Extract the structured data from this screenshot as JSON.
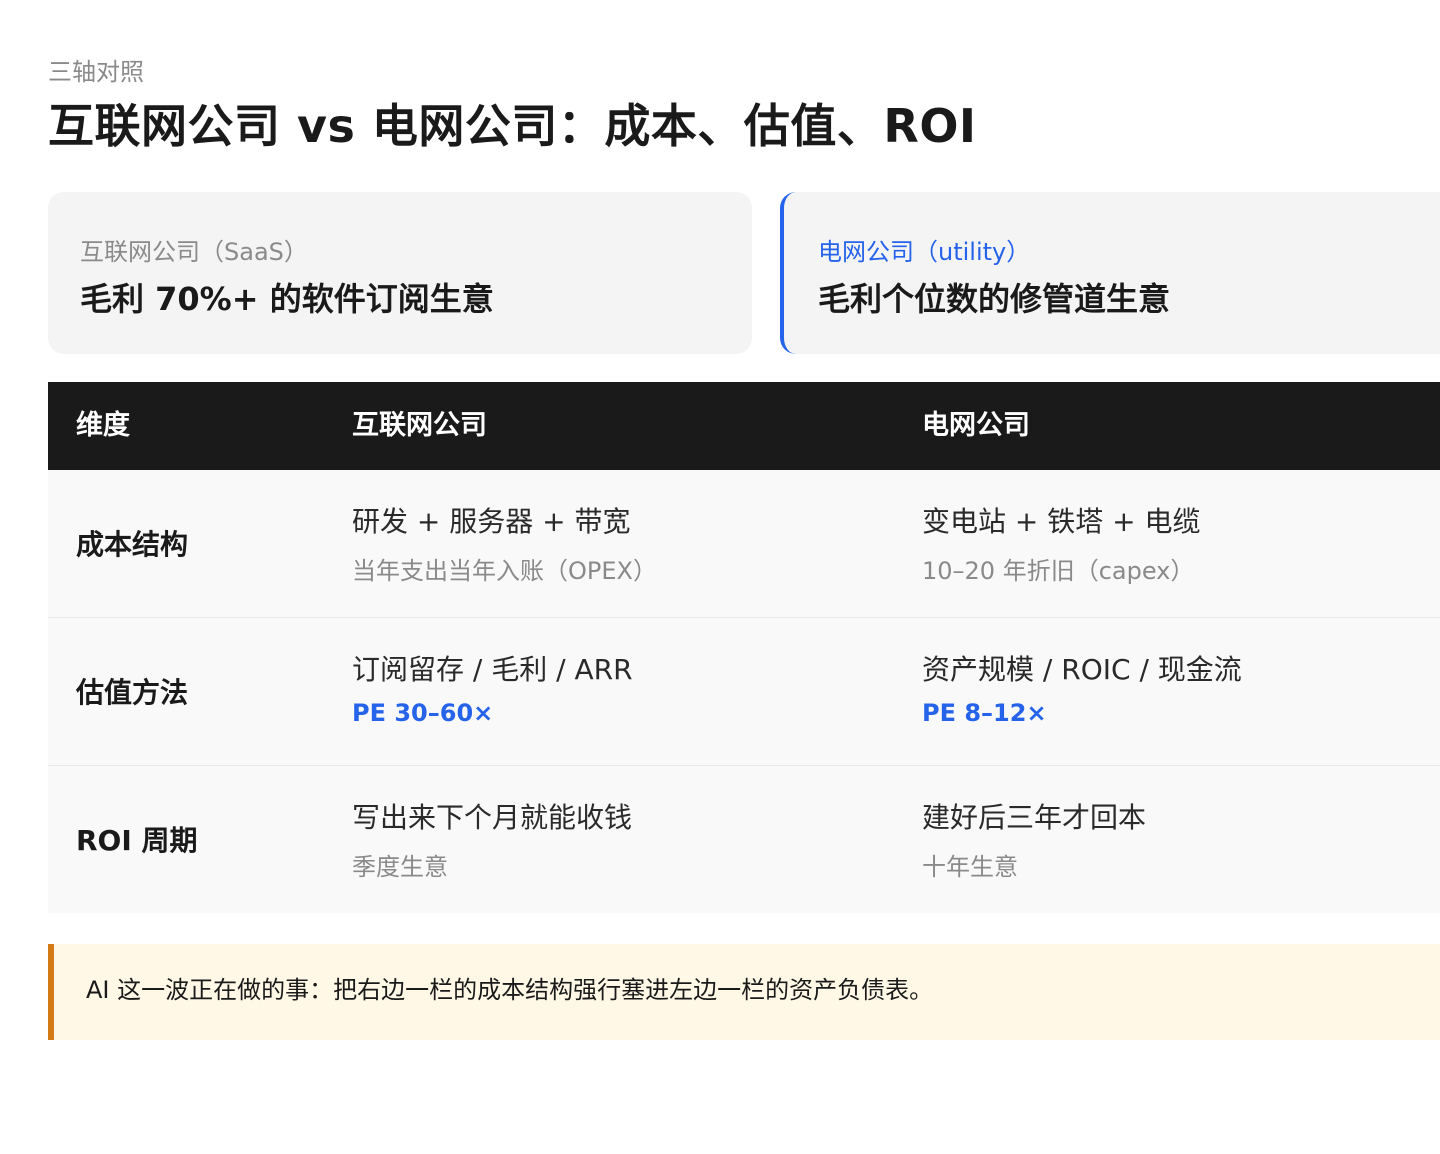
{
  "header": {
    "eyebrow": "三轴对照",
    "title": "互联网公司 vs 电网公司：成本、估值、ROI"
  },
  "cards": {
    "left": {
      "label": "互联网公司（SaaS）",
      "headline": "毛利 70%+ 的软件订阅生意"
    },
    "right": {
      "label": "电网公司（utility）",
      "headline": "毛利个位数的修管道生意",
      "accent_color": "#2563eb"
    }
  },
  "table": {
    "columns": [
      "维度",
      "互联网公司",
      "电网公司"
    ],
    "rows": [
      {
        "dimension": "成本结构",
        "internet": {
          "main": "研发 + 服务器 + 带宽",
          "sub": "当年支出当年入账（OPEX）"
        },
        "grid": {
          "main": "变电站 + 铁塔 + 电缆",
          "sub": "10–20 年折旧（capex）"
        }
      },
      {
        "dimension": "估值方法",
        "internet": {
          "main": "订阅留存 / 毛利 / ARR",
          "sub": "PE 30–60×"
        },
        "grid": {
          "main": "资产规模 / ROIC / 现金流",
          "sub": "PE 8–12×"
        }
      },
      {
        "dimension": "ROI 周期",
        "internet": {
          "main": "写出来下个月就能收钱",
          "sub": "季度生意"
        },
        "grid": {
          "main": "建好后三年才回本",
          "sub": "十年生意"
        }
      }
    ]
  },
  "callout": {
    "text": "AI 这一波正在做的事：把右边一栏的成本结构强行塞进左边一栏的资产负债表。",
    "accent_color": "#d47a14"
  }
}
